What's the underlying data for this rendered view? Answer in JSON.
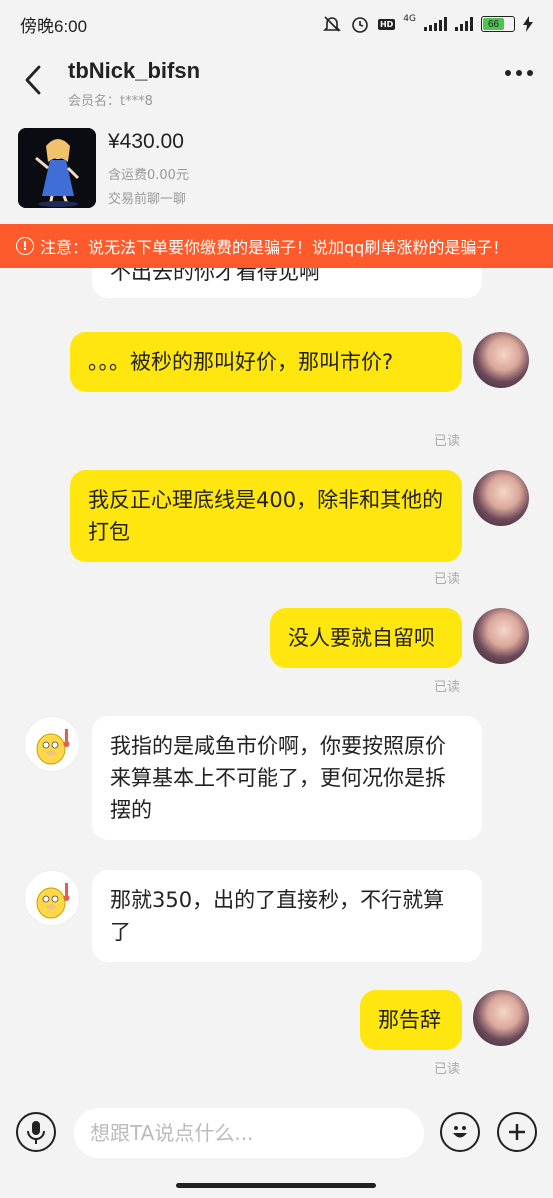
{
  "status_bar": {
    "time": "傍晚6:00",
    "network": "4G",
    "hd": "HD",
    "battery": "66"
  },
  "header": {
    "title": "tbNick_bifsn",
    "member": "会员名：t***8"
  },
  "product": {
    "price": "¥430.00",
    "shipping": "含运费0.00元",
    "note": "交易前聊一聊"
  },
  "warning": {
    "text": "注意：说无法下单要你缴费的是骗子！说加qq刷单涨粉的是骗子！"
  },
  "messages": [
    {
      "side": "them",
      "text": "不出去的你才看得见啊"
    },
    {
      "side": "me",
      "text": "。。。被秒的那叫好价，那叫市价?",
      "status": "已读"
    },
    {
      "side": "me",
      "text": "我反正心理底线是400，除非和其他的打包",
      "status": "已读"
    },
    {
      "side": "me",
      "text": "没人要就自留呗",
      "status": "已读"
    },
    {
      "side": "them",
      "text": "我指的是咸鱼市价啊，你要按照原价来算基本上不可能了，更何况你是拆摆的"
    },
    {
      "side": "them",
      "text": "那就350，出的了直接秒，不行就算了"
    },
    {
      "side": "me",
      "text": "那告辞",
      "status": "已读"
    }
  ],
  "input": {
    "placeholder": "想跟TA说点什么..."
  },
  "colors": {
    "my_bubble": "#ffe60f",
    "warning": "#ff5a2b"
  }
}
